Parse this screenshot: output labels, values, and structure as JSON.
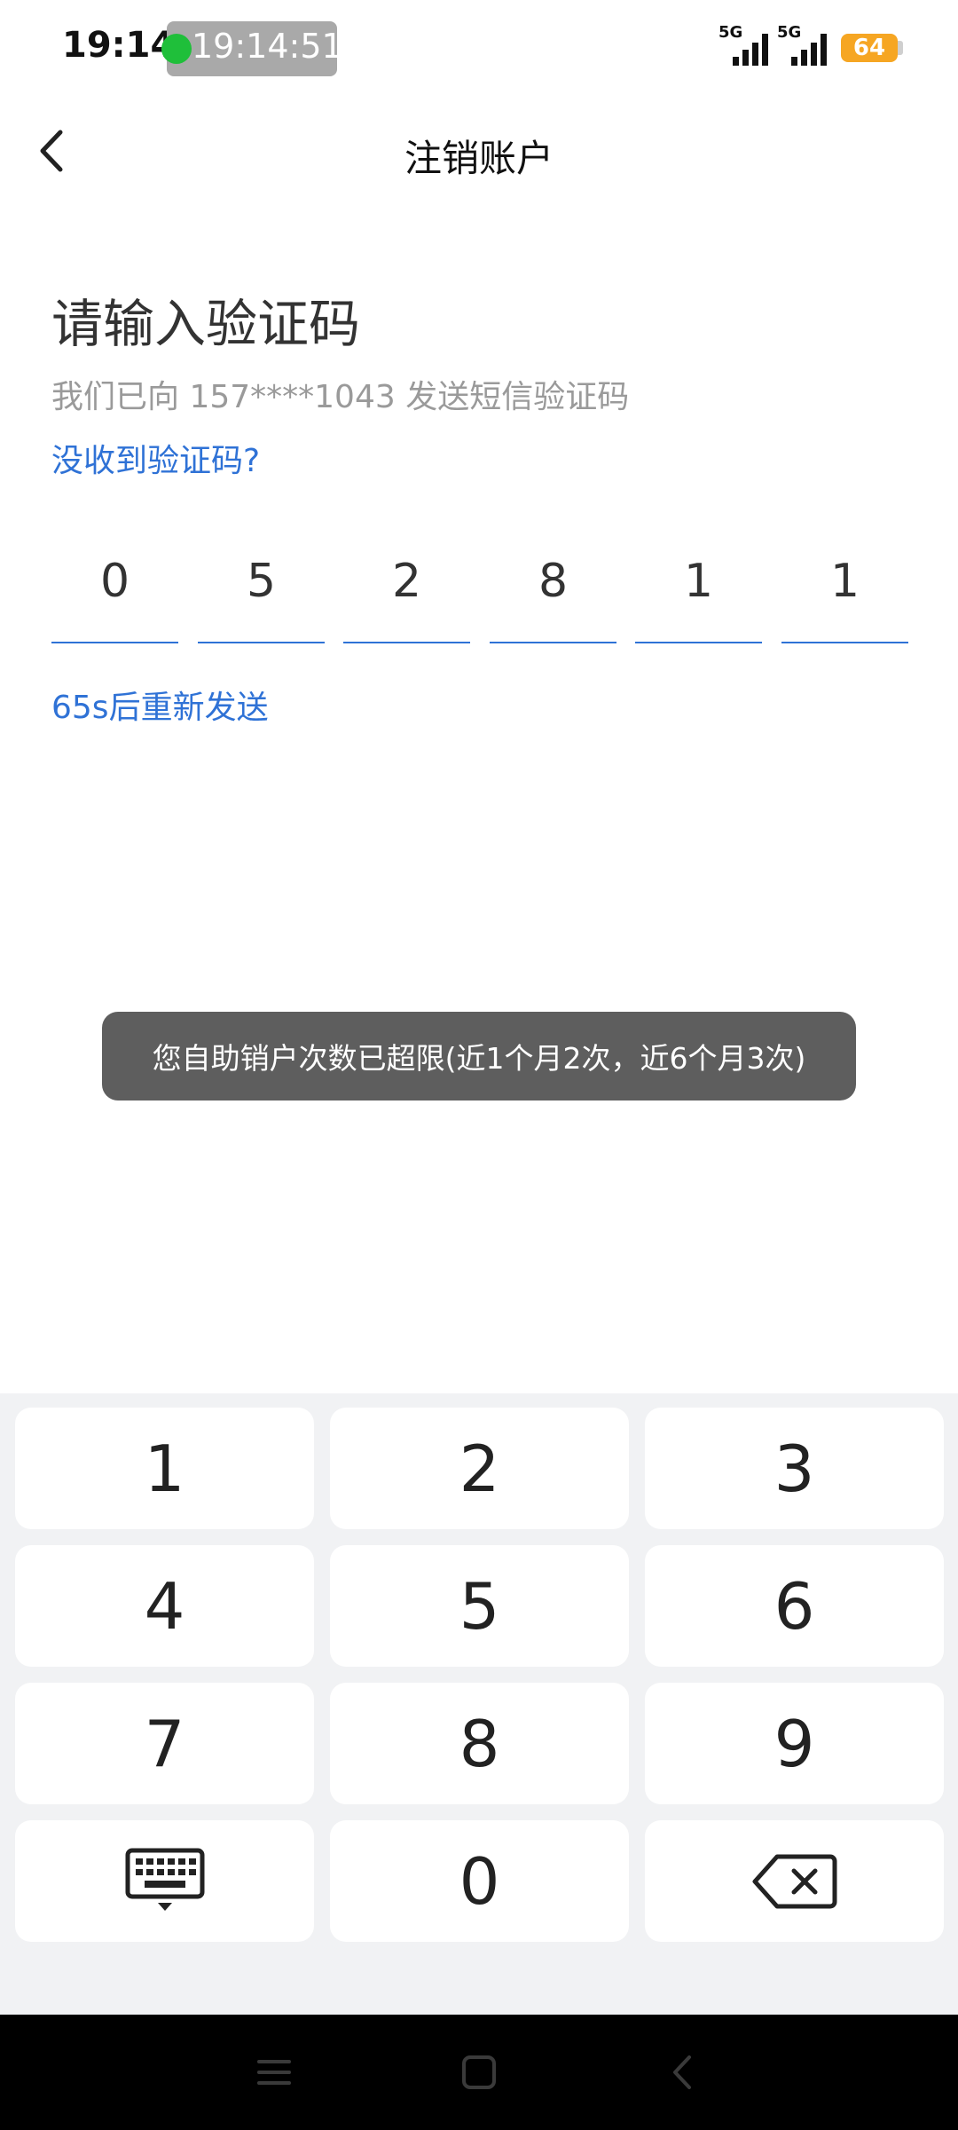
{
  "status_bar": {
    "time": "19:14",
    "clock_chip": "19:14:51",
    "signal_1": "5G",
    "signal_2": "5G",
    "battery": "64"
  },
  "header": {
    "title": "注销账户"
  },
  "main": {
    "heading": "请输入验证码",
    "sent_hint": "我们已向 157****1043 发送短信验证码",
    "no_code_link": "没收到验证码?",
    "otp": [
      "0",
      "5",
      "2",
      "8",
      "1",
      "1"
    ],
    "resend": "65s后重新发送"
  },
  "toast": {
    "message": "您自助销户次数已超限(近1个月2次，近6个月3次)"
  },
  "keypad": {
    "keys": [
      "1",
      "2",
      "3",
      "4",
      "5",
      "6",
      "7",
      "8",
      "9"
    ],
    "zero": "0"
  },
  "colors": {
    "accent": "#2f72d6",
    "toast_bg": "#5e5e5e",
    "battery": "#f6a623"
  }
}
